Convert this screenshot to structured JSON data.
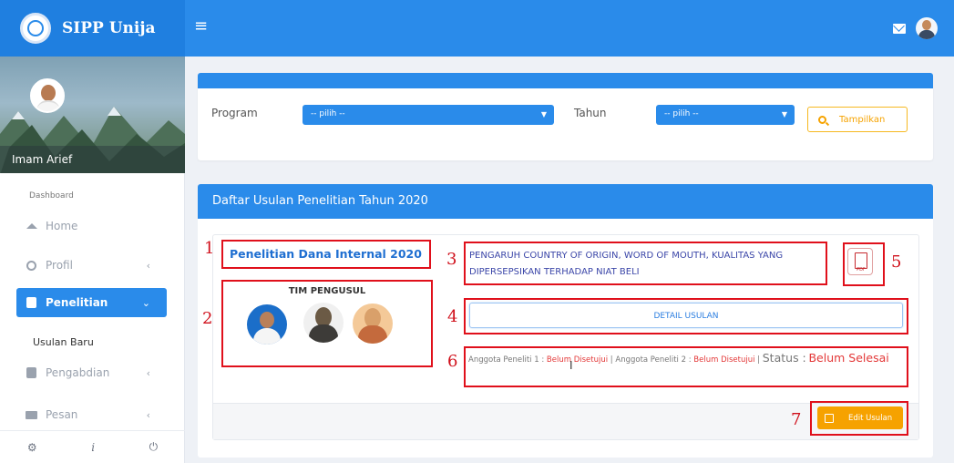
{
  "app": {
    "name": "SIPP Unija"
  },
  "topbar": {
    "menu_icon": "hamburger-icon",
    "mail_icon": "mail-icon",
    "avatar": "user-avatar"
  },
  "sidebar": {
    "user_name": "Imam Arief",
    "section_label": "Dashboard",
    "items": [
      {
        "label": "Home",
        "icon": "home-icon"
      },
      {
        "label": "Profil",
        "icon": "user-icon",
        "chevron": "‹"
      },
      {
        "label": "Penelitian",
        "icon": "book-icon",
        "chevron": "⌄",
        "active": true
      },
      {
        "label": "Usulan Baru"
      },
      {
        "label": "Pengabdian",
        "icon": "book-icon",
        "chevron": "‹"
      },
      {
        "label": "Pesan",
        "icon": "mail-icon",
        "chevron": "‹"
      }
    ],
    "footer": {
      "settings": "⚙",
      "info": "i",
      "power": "⏻"
    }
  },
  "filter": {
    "program_label": "Program",
    "program_value": "-- pilih --",
    "tahun_label": "Tahun",
    "tahun_value": "-- pilih --",
    "button_label": "Tampilkan"
  },
  "list": {
    "heading": "Daftar Usulan Penelitian Tahun 2020",
    "proposal": {
      "hibah": "Penelitian Dana Internal 2020",
      "team_title": "TIM PENGUSUL",
      "judul": "PENGARUH COUNTRY OF ORIGIN, WORD OF MOUTH, KUALITAS YANG DIPERSEPSIKAN TERHADAP NIAT BELI",
      "pdf_label": "PDF",
      "detail_button": "DETAIL USULAN",
      "anggota1_label": "Anggota Peneliti 1 :",
      "anggota1_status": "Belum Disetujui",
      "separator": "|",
      "anggota2_label": "Anggota Peneliti 2 :",
      "anggota2_status": "Belum Disetujui",
      "status_label": "Status :",
      "status_value": "Belum Selesai",
      "edit_button": "Edit Usulan"
    }
  },
  "annotations": [
    "1",
    "2",
    "3",
    "4",
    "5",
    "6",
    "7"
  ],
  "colors": {
    "primary": "#2a8bea",
    "warning": "#f6a200",
    "annotation": "#e0101b"
  }
}
